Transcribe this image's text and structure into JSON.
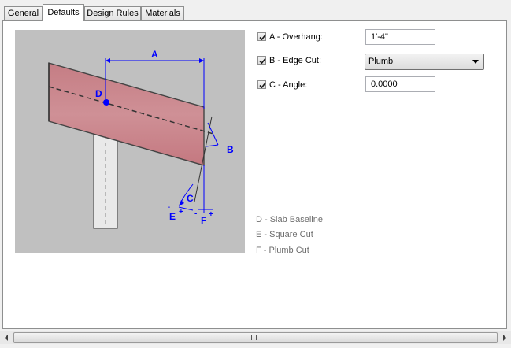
{
  "tabs": [
    {
      "label": "General"
    },
    {
      "label": "Defaults",
      "active": true
    },
    {
      "label": "Design Rules"
    },
    {
      "label": "Materials"
    }
  ],
  "diagram": {
    "labels": {
      "a": "A",
      "b": "B",
      "c": "C",
      "d": "D",
      "e": "E",
      "f": "F",
      "minus": "-",
      "plus": "+"
    },
    "colors": {
      "background": "#c0c0c0",
      "rafter": "#c9858a",
      "dimension": "#0000ff",
      "post": "#e6e6e6"
    }
  },
  "fields": {
    "overhang": {
      "label": "A - Overhang:",
      "checked": true,
      "value": "1'-4\""
    },
    "edge_cut": {
      "label": "B - Edge Cut:",
      "checked": true,
      "value": "Plumb"
    },
    "angle": {
      "label": "C - Angle:",
      "checked": true,
      "value": "0.0000"
    }
  },
  "legend": [
    {
      "text": "D - Slab Baseline"
    },
    {
      "text": "E - Square Cut"
    },
    {
      "text": "F - Plumb Cut"
    }
  ],
  "scrollbar": {
    "left_icon": "arrow-left-icon",
    "right_icon": "arrow-right-icon",
    "grip_icon": "grip-icon"
  }
}
